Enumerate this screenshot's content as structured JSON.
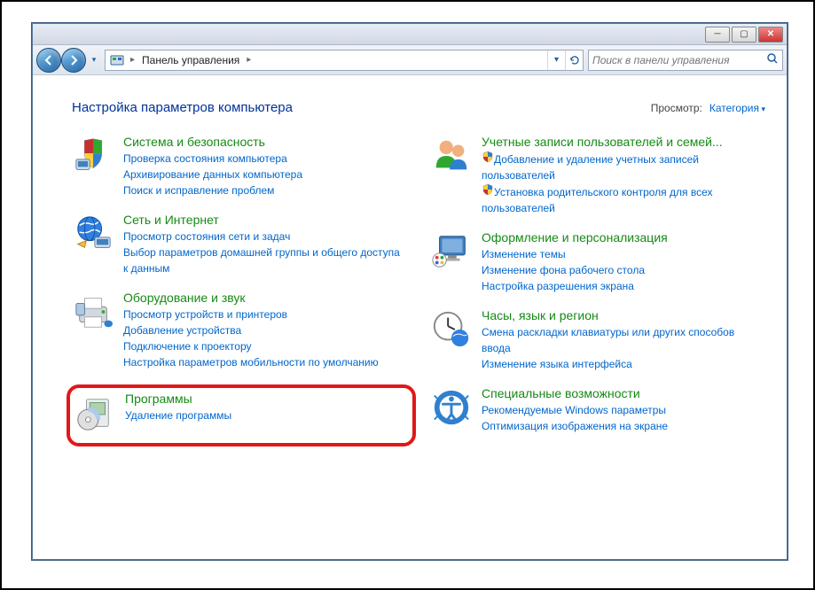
{
  "window": {
    "breadcrumb_root": "Панель управления",
    "search_placeholder": "Поиск в панели управления"
  },
  "heading": "Настройка параметров компьютера",
  "view": {
    "label": "Просмотр:",
    "value": "Категория"
  },
  "left": [
    {
      "key": "system",
      "title": "Система и безопасность",
      "icon": "shield-pc",
      "links": [
        {
          "text": "Проверка состояния компьютера"
        },
        {
          "text": "Архивирование данных компьютера"
        },
        {
          "text": "Поиск и исправление проблем"
        }
      ]
    },
    {
      "key": "network",
      "title": "Сеть и Интернет",
      "icon": "globe-net",
      "links": [
        {
          "text": "Просмотр состояния сети и задач"
        },
        {
          "text": "Выбор параметров домашней группы и общего доступа к данным"
        }
      ]
    },
    {
      "key": "hardware",
      "title": "Оборудование и звук",
      "icon": "printer",
      "links": [
        {
          "text": "Просмотр устройств и принтеров"
        },
        {
          "text": "Добавление устройства"
        },
        {
          "text": "Подключение к проектору"
        },
        {
          "text": "Настройка параметров мобильности по умолчанию"
        }
      ]
    },
    {
      "key": "programs",
      "title": "Программы",
      "icon": "disc-box",
      "highlight": true,
      "links": [
        {
          "text": "Удаление программы"
        }
      ]
    }
  ],
  "right": [
    {
      "key": "users",
      "title": "Учетные записи пользователей и семей...",
      "icon": "users",
      "links": [
        {
          "text": "Добавление и удаление учетных записей пользователей",
          "shield": true
        },
        {
          "text": "Установка родительского контроля для всех пользователей",
          "shield": true
        }
      ]
    },
    {
      "key": "appearance",
      "title": "Оформление и персонализация",
      "icon": "monitor-paint",
      "links": [
        {
          "text": "Изменение темы"
        },
        {
          "text": "Изменение фона рабочего стола"
        },
        {
          "text": "Настройка разрешения экрана"
        }
      ]
    },
    {
      "key": "clock",
      "title": "Часы, язык и регион",
      "icon": "clock-globe",
      "links": [
        {
          "text": "Смена раскладки клавиатуры или других способов ввода"
        },
        {
          "text": "Изменение языка интерфейса"
        }
      ]
    },
    {
      "key": "ease",
      "title": "Специальные возможности",
      "icon": "ease-access",
      "links": [
        {
          "text": "Рекомендуемые Windows параметры"
        },
        {
          "text": "Оптимизация изображения на экране"
        }
      ]
    }
  ]
}
